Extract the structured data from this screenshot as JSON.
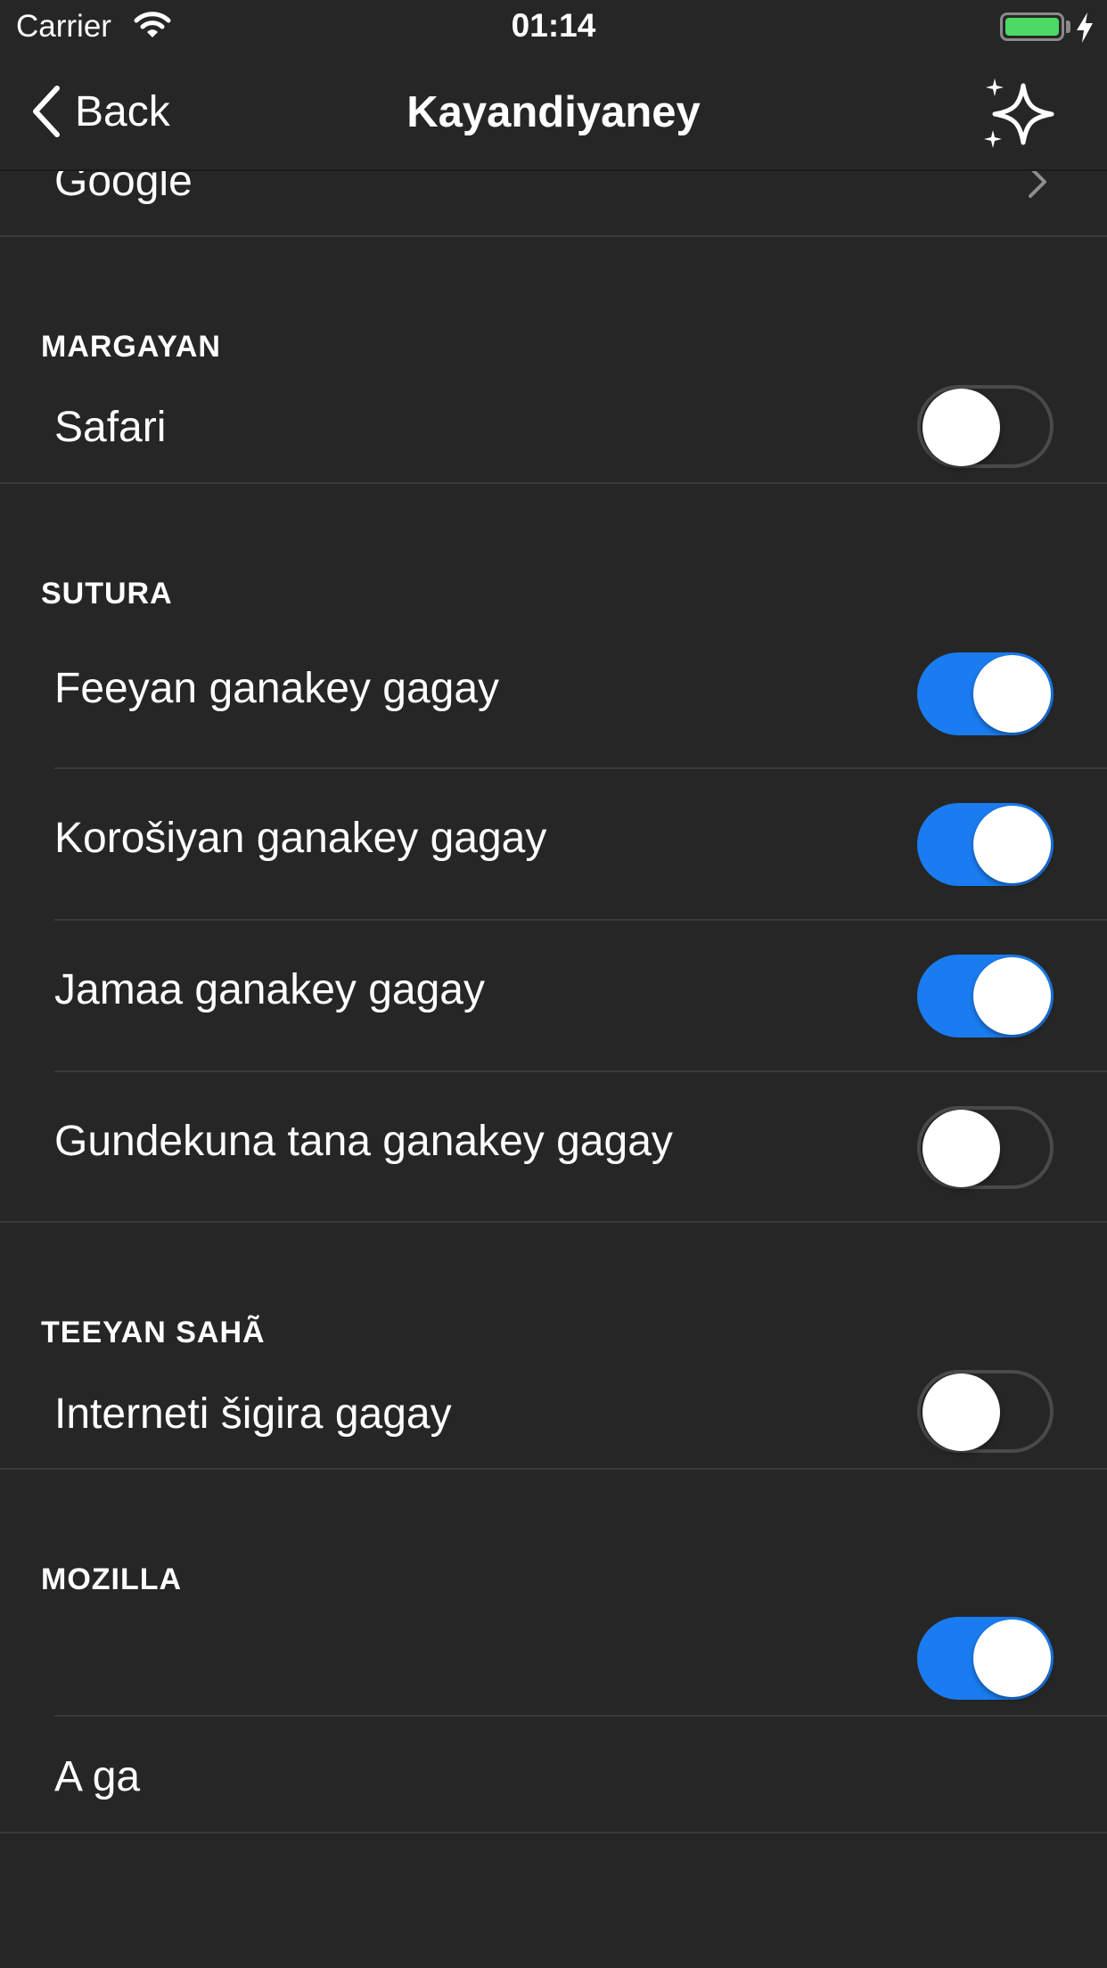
{
  "status_bar": {
    "carrier": "Carrier",
    "time": "01:14",
    "battery_color": "#4cd964"
  },
  "nav": {
    "back_label": "Back",
    "title": "Kayandiyaney",
    "right_icon": "sparkles-icon"
  },
  "partial_row": {
    "label": "Google"
  },
  "sections": {
    "margayan": {
      "header": "MARGAYAN",
      "rows": [
        {
          "label": "Safari",
          "enabled": false
        }
      ]
    },
    "sutura": {
      "header": "SUTURA",
      "rows": [
        {
          "label": "Feeyan ganakey gagay",
          "enabled": true
        },
        {
          "label": "Korošiyan ganakey gagay",
          "enabled": true
        },
        {
          "label": "Jamaa ganakey gagay",
          "enabled": true
        },
        {
          "label": "Gundekuna tana ganakey gagay",
          "enabled": false
        }
      ]
    },
    "teeyan_saha": {
      "header": "TEEYAN SAHÃ",
      "rows": [
        {
          "label": "Interneti šigira gagay",
          "enabled": false
        }
      ]
    },
    "mozilla": {
      "header": "MOZILLA",
      "rows": [
        {
          "label": "",
          "enabled": true
        },
        {
          "label": "A ga"
        }
      ]
    }
  },
  "colors": {
    "background": "#262626",
    "toggle_on": "#1a7cf0",
    "toggle_off_border": "#4a4a4a"
  }
}
